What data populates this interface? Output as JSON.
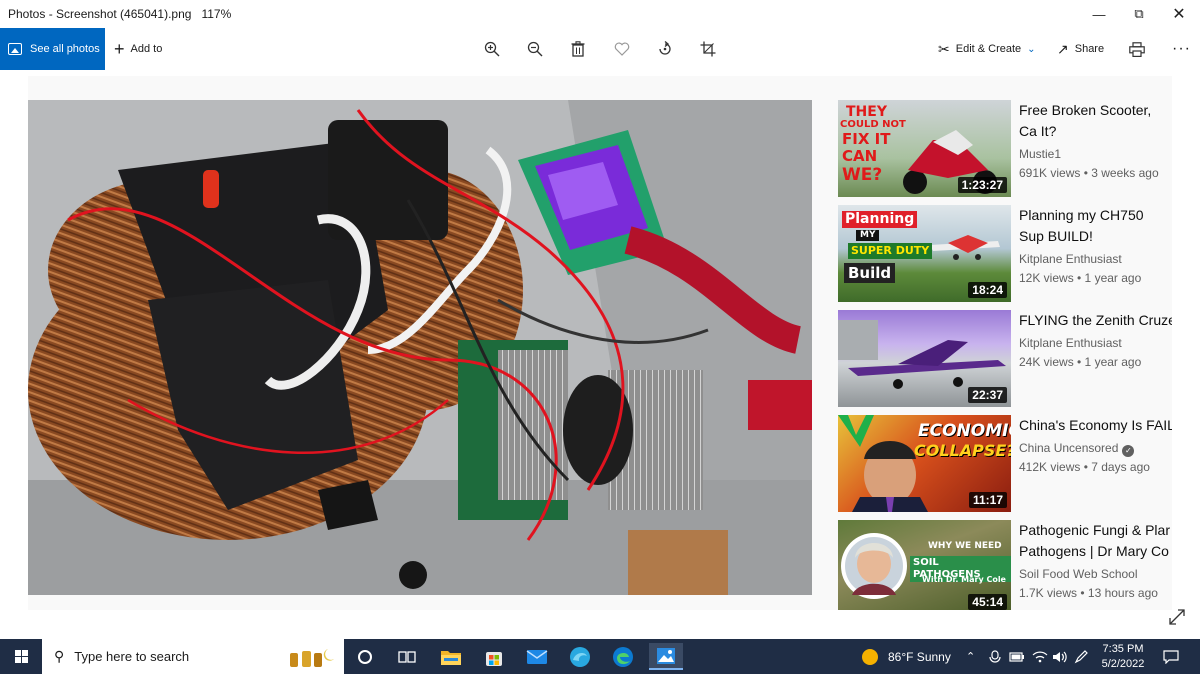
{
  "titlebar": {
    "title": "Photos - Screenshot (465041).png",
    "zoom": "117%"
  },
  "toolbar": {
    "see_all": "See all photos",
    "add_to": "Add to",
    "edit_create": "Edit & Create",
    "share": "Share"
  },
  "videos": [
    {
      "title": "Free Broken Scooter, Ca It?",
      "channel": "Mustie1",
      "meta": "691K views • 3 weeks ago",
      "duration": "1:23:27",
      "thumb_lines": [
        "THEY",
        "COULD NOT",
        "FIX IT",
        "CAN",
        "WE?"
      ]
    },
    {
      "title": "Planning my CH750 Sup BUILD!",
      "channel": "Kitplane Enthusiast",
      "meta": "12K views • 1 year ago",
      "duration": "18:24",
      "thumb_lines": [
        "Planning",
        "MY",
        "SUPER DUTY",
        "Build"
      ]
    },
    {
      "title": "FLYING the Zenith Cruze",
      "channel": "Kitplane Enthusiast",
      "meta": "24K views • 1 year ago",
      "duration": "22:37"
    },
    {
      "title": "China's Economy Is FAIL",
      "channel": "China Uncensored",
      "meta": "412K views • 7 days ago",
      "duration": "11:17",
      "thumb_lines": [
        "ECONOMIC",
        "COLLAPSE?"
      ]
    },
    {
      "title": "Pathogenic Fungi & Plar Pathogens | Dr Mary Co",
      "channel": "Soil Food Web School",
      "meta": "1.7K views • 13 hours ago",
      "duration": "45:14",
      "thumb_lines": [
        "WHY WE NEED",
        "SOIL PATHOGENS",
        "With Dr. Mary Cole"
      ]
    }
  ],
  "taskbar": {
    "search_placeholder": "Type here to search",
    "weather": "86°F  Sunny",
    "time": "7:35 PM",
    "date": "5/2/2022"
  }
}
